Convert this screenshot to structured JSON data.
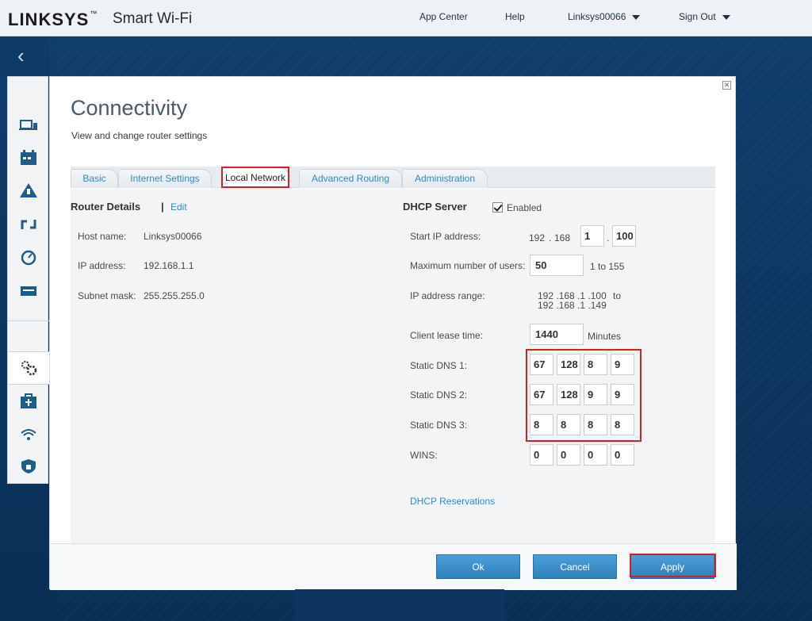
{
  "header": {
    "brand": "LINKSYS",
    "brand_tm": "™",
    "brand_sub": "Smart Wi-Fi",
    "nav": {
      "app_center": "App Center",
      "help": "Help",
      "account": "Linksys00066",
      "sign_out": "Sign Out"
    }
  },
  "modal": {
    "title": "Connectivity",
    "subtitle": "View and change router settings",
    "close_glyph": "✕",
    "tabs": [
      {
        "label": "Basic"
      },
      {
        "label": "Internet Settings"
      },
      {
        "label": "Local Network"
      },
      {
        "label": "Advanced Routing"
      },
      {
        "label": "Administration"
      }
    ],
    "active_tab": "Local Network"
  },
  "router_details": {
    "heading": "Router Details",
    "separator": "|",
    "edit_label": "Edit",
    "host_name_label": "Host name:",
    "host_name": "Linksys00066",
    "ip_address_label": "IP address:",
    "ip_address": "192.168.1.1",
    "subnet_mask_label": "Subnet mask:",
    "subnet_mask": "255.255.255.0"
  },
  "dhcp": {
    "heading": "DHCP Server",
    "enabled_label": "Enabled",
    "enabled": true,
    "start_ip_label": "Start IP address:",
    "start_ip_fixed_1": "192",
    "start_ip_fixed_2": "168",
    "start_ip_octet3": "1",
    "start_ip_octet4": "100",
    "max_users_label": "Maximum number of users:",
    "max_users": "50",
    "max_users_range": "1 to 155",
    "ip_range_label": "IP address range:",
    "ip_range_start": "192 .168 .1 .100",
    "ip_range_to": "to",
    "ip_range_end": "192 .168 .1 .149",
    "lease_label": "Client lease time:",
    "lease_value": "1440",
    "lease_unit": "Minutes",
    "dns1_label": "Static DNS 1:",
    "dns1": [
      "67",
      "128",
      "8",
      "9"
    ],
    "dns2_label": "Static DNS 2:",
    "dns2": [
      "67",
      "128",
      "9",
      "9"
    ],
    "dns3_label": "Static DNS 3:",
    "dns3": [
      "8",
      "8",
      "8",
      "8"
    ],
    "wins_label": "WINS:",
    "wins": [
      "0",
      "0",
      "0",
      "0"
    ],
    "reservations_label": "DHCP Reservations"
  },
  "footer": {
    "ok": "Ok",
    "cancel": "Cancel",
    "apply": "Apply"
  },
  "colors": {
    "accent": "#2b8cc4",
    "highlight": "#d32027",
    "background": "#0e3a66"
  }
}
